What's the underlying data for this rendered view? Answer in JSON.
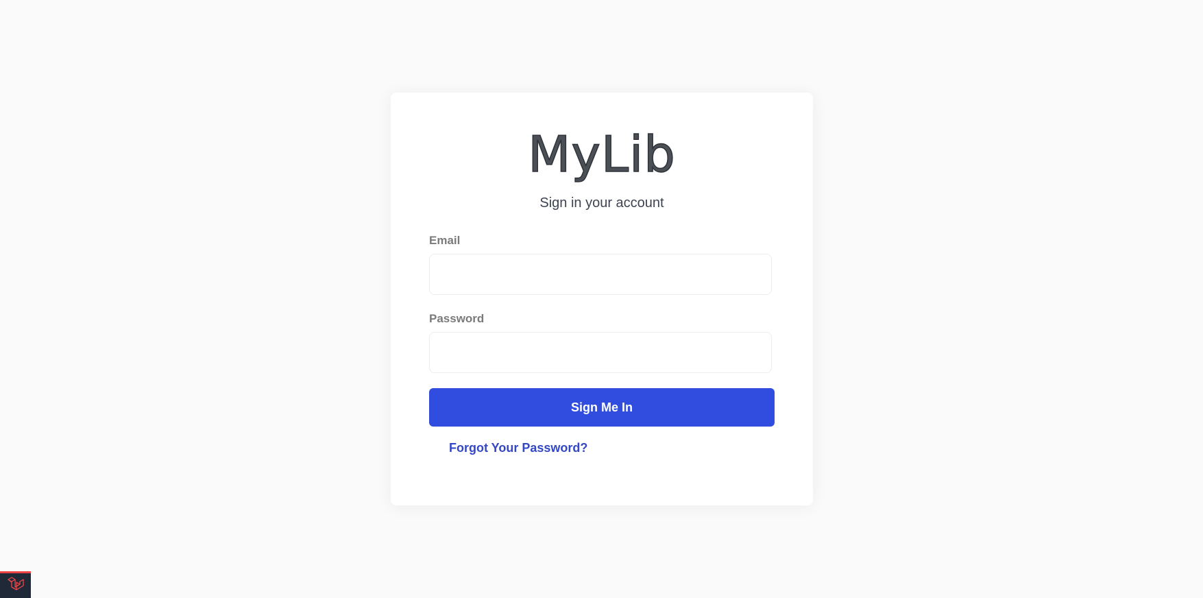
{
  "brand": {
    "logo_text": "MyLib"
  },
  "login": {
    "subtitle": "Sign in your account",
    "email_label": "Email",
    "email_value": "",
    "password_label": "Password",
    "password_value": "",
    "submit_label": "Sign Me In",
    "forgot_label": "Forgot Your Password?"
  },
  "colors": {
    "background": "#fafafa",
    "card": "#ffffff",
    "primary": "#314ddf",
    "link": "#3448c5",
    "debug_bar": "#1f2937",
    "debug_accent": "#ef4444"
  },
  "icons": {
    "debug": "laravel-icon"
  }
}
